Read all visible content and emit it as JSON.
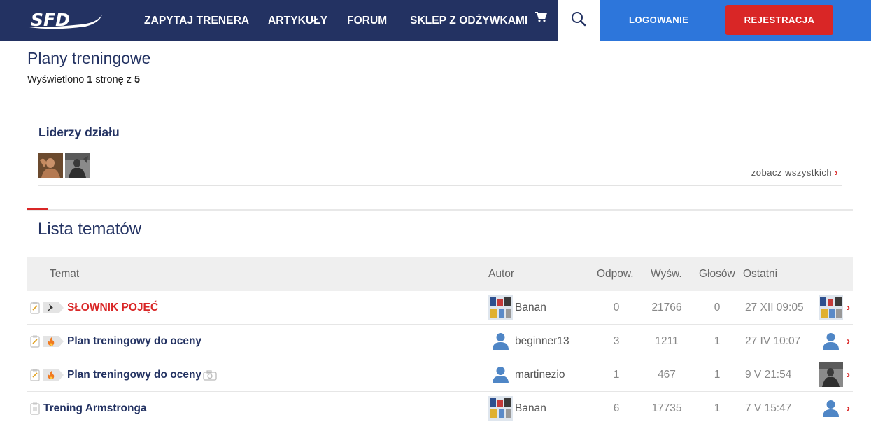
{
  "nav": {
    "logo_text": "SFD",
    "links": [
      "ZAPYTAJ TRENERA",
      "ARTYKUŁY",
      "FORUM",
      "SKLEP Z ODŻYWKAMI"
    ],
    "login_label": "LOGOWANIE",
    "register_label": "REJESTRACJA"
  },
  "header": {
    "title": "Plany treningowe",
    "info_prefix": "Wyświetlono ",
    "info_page": "1",
    "info_middle": " stronę z ",
    "info_total": "5"
  },
  "leaders": {
    "title": "Liderzy działu",
    "see_all": "zobacz wszystkich"
  },
  "topics": {
    "title": "Lista tematów",
    "columns": [
      "Temat",
      "Autor",
      "Odpow.",
      "Wyśw.",
      "Głosów",
      "Ostatni"
    ],
    "rows": [
      {
        "title": "SŁOWNIK POJĘĆ",
        "author": "Banan",
        "replies": "0",
        "views": "21766",
        "votes": "0",
        "last": "27 XII 09:05"
      },
      {
        "title": "Plan treningowy do oceny",
        "author": "beginner13",
        "replies": "3",
        "views": "1211",
        "votes": "1",
        "last": "27 IV 10:07"
      },
      {
        "title": "Plan treningowy do oceny",
        "author": "martinezio",
        "replies": "1",
        "views": "467",
        "votes": "1",
        "last": "9 V 21:54"
      },
      {
        "title": "Trening Armstronga",
        "author": "Banan",
        "replies": "6",
        "views": "17735",
        "votes": "1",
        "last": "7 V 15:47"
      }
    ]
  },
  "colors": {
    "navy": "#233262",
    "blue": "#2d76db",
    "red": "#d92626"
  }
}
